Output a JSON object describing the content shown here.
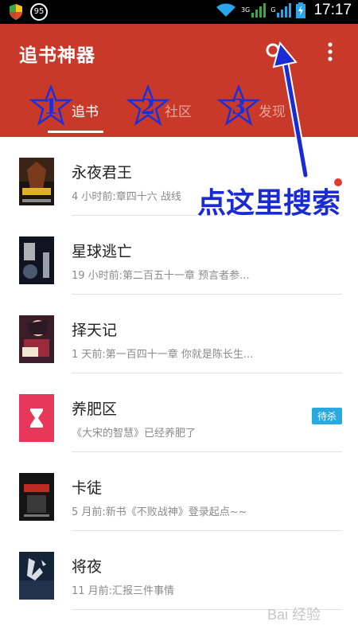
{
  "status_bar": {
    "battery_level": "95",
    "network_g": "G",
    "network_3g": "3G",
    "time": "17:17"
  },
  "app_bar": {
    "title": "追书神器",
    "tabs": [
      {
        "label": "追书",
        "active": true
      },
      {
        "label": "社区",
        "active": false
      },
      {
        "label": "发现",
        "active": false
      }
    ]
  },
  "annotations": {
    "stars": [
      "1",
      "2",
      "3"
    ],
    "callout": "点这里搜索",
    "callout_color": "#1a2bd4"
  },
  "books": [
    {
      "title": "永夜君王",
      "subtitle": "4 小时前:章四十六 战线",
      "cover": "book-cover-dark-red",
      "badge": "",
      "unread_dot": true
    },
    {
      "title": "星球逃亡",
      "subtitle": "19 小时前:第二百五十一章 预言者参...",
      "cover": "book-cover-space",
      "badge": "",
      "unread_dot": false
    },
    {
      "title": "择天记",
      "subtitle": "1 天前:第一百四十一章 你就是陈长生...",
      "cover": "book-cover-anime",
      "badge": "",
      "unread_dot": false
    },
    {
      "title": "养肥区",
      "subtitle": "《大宋的智慧》已经养肥了",
      "cover": "hourglass-folder",
      "badge": "待杀",
      "unread_dot": false
    },
    {
      "title": "卡徒",
      "subtitle": "5 月前:新书《不败战神》登录起点~~",
      "cover": "book-cover-dark",
      "badge": "",
      "unread_dot": false
    },
    {
      "title": "将夜",
      "subtitle": "11 月前:汇报三件事情",
      "cover": "book-cover-blue",
      "badge": "",
      "unread_dot": false
    }
  ],
  "watermark": "Bai 经验",
  "colors": {
    "app_bar": "#c8392a",
    "badge": "#29a9e0",
    "hourglass_bg": "#e8385a"
  }
}
